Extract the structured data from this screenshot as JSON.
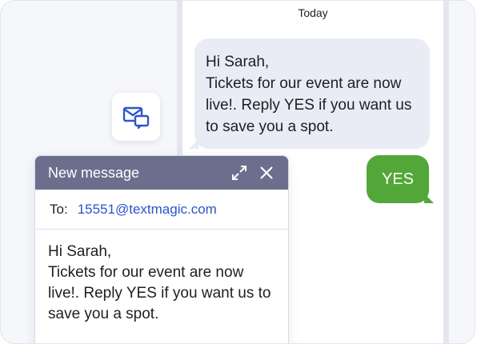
{
  "thread": {
    "date_label": "Today",
    "incoming_message": "Hi Sarah,\nTickets for our event are now live!. Reply YES if you want us to save you a spot.",
    "outgoing_message": "YES"
  },
  "compose": {
    "title": "New message",
    "to_label": "To:",
    "to_value": "15551@textmagic.com",
    "body": "Hi Sarah,\nTickets for our event are now live!. Reply YES if you want us to save you a spot.",
    "header_icons": [
      "expand-icon",
      "close-icon"
    ]
  },
  "side_icon": "email-to-sms-icon",
  "colors": {
    "incoming_bubble": "#e9ecf5",
    "outgoing_bubble": "#53a738",
    "compose_header": "#6c6e8e",
    "link": "#2a55c9"
  }
}
